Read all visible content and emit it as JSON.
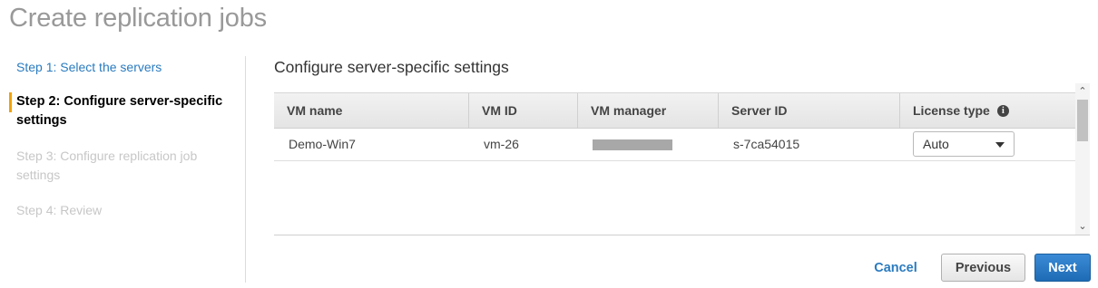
{
  "page": {
    "title": "Create replication jobs"
  },
  "steps": [
    {
      "label": "Step 1: Select the servers"
    },
    {
      "label": "Step 2: Configure server-specific settings"
    },
    {
      "label": "Step 3: Configure replication job settings"
    },
    {
      "label": "Step 4: Review"
    }
  ],
  "active_step": 2,
  "colors": {
    "link": "#2a7bbf",
    "active_marker": "#f0a30a",
    "primary_button": "#1f6bb5",
    "disabled_text": "#c7c7c7"
  },
  "section": {
    "title": "Configure server-specific settings"
  },
  "table": {
    "columns": [
      "VM name",
      "VM ID",
      "VM manager",
      "Server ID",
      "License type"
    ],
    "rows": [
      {
        "vm_name": "Demo-Win7",
        "vm_id": "vm-26",
        "vm_manager": "",
        "server_id": "s-7ca54015",
        "license_type": "Auto"
      }
    ]
  },
  "icons": {
    "info": "info-icon",
    "dropdown": "chevron-down-icon",
    "scroll_up": "scroll-up-icon",
    "scroll_down": "scroll-down-icon"
  },
  "buttons": {
    "cancel": "Cancel",
    "previous": "Previous",
    "next": "Next"
  }
}
